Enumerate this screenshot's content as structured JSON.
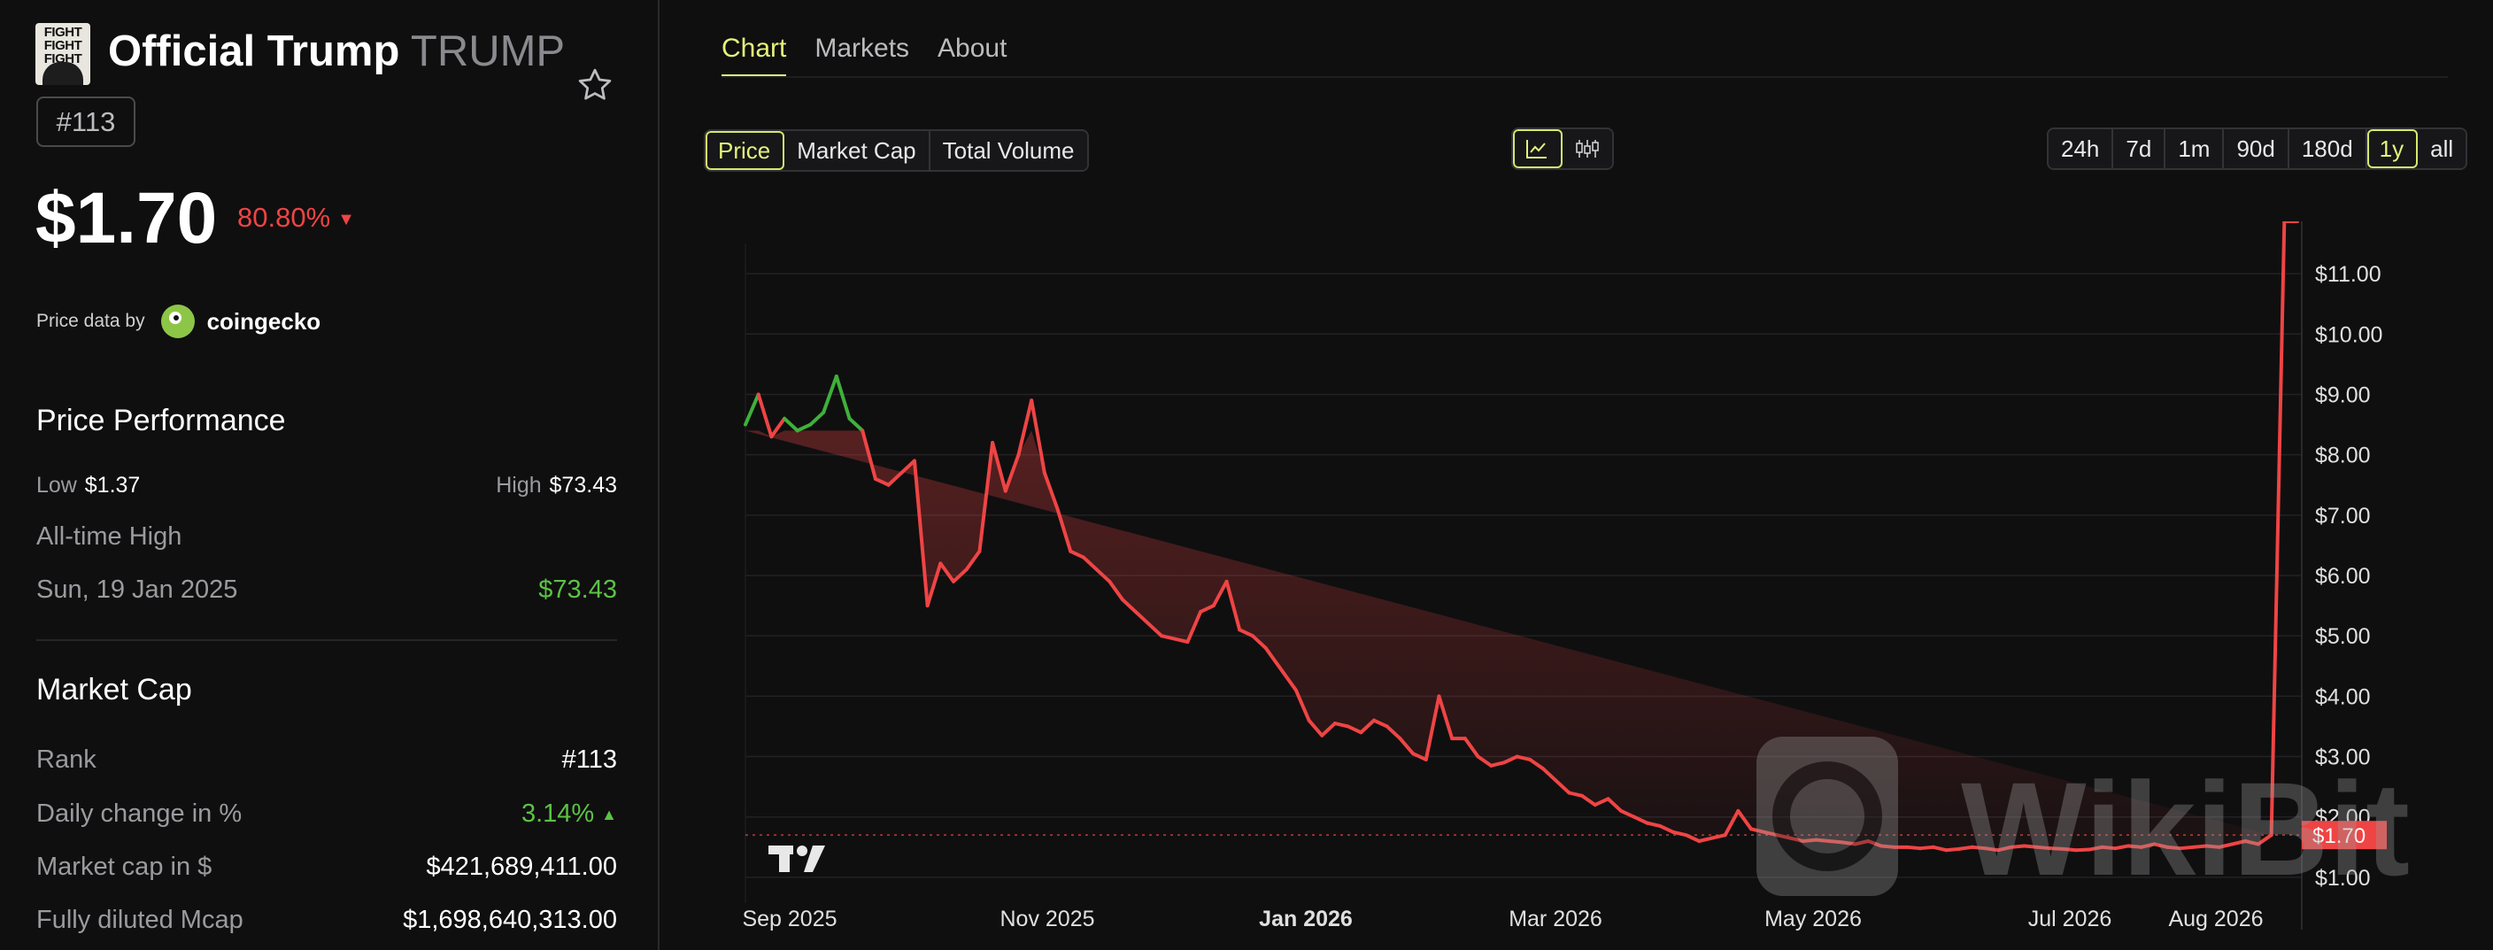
{
  "coin": {
    "name": "Official Trump",
    "symbol": "TRUMP",
    "rank_badge": "#113",
    "price": "$1.70",
    "change": "80.80%",
    "logo_text": [
      "FIGHT",
      "FIGHT",
      "FIGHT"
    ]
  },
  "price_data": {
    "by": "Price data by",
    "provider": "coingecko"
  },
  "performance": {
    "title": "Price Performance",
    "low_label": "Low",
    "low_value": "$1.37",
    "high_label": "High",
    "high_value": "$73.43",
    "ath_label": "All-time High",
    "ath_date": "Sun, 19 Jan 2025",
    "ath_value": "$73.43"
  },
  "market_cap": {
    "title": "Market Cap",
    "rank_label": "Rank",
    "rank_value": "#113",
    "daily_label": "Daily change in %",
    "daily_value": "3.14%",
    "mcap_label": "Market cap in $",
    "mcap_value": "$421,689,411.00",
    "fdv_label": "Fully diluted Mcap",
    "fdv_value": "$1,698,640,313.00"
  },
  "tabs": [
    "Chart",
    "Markets",
    "About"
  ],
  "metric_buttons": [
    "Price",
    "Market Cap",
    "Total Volume"
  ],
  "range_buttons": [
    "24h",
    "7d",
    "1m",
    "90d",
    "180d",
    "1y",
    "all"
  ],
  "colors": {
    "accent": "#e5f27a",
    "down": "#ef4444",
    "up": "#4ade80"
  },
  "watermark": "WikiBit",
  "chart_data": {
    "type": "line",
    "x_ticks": [
      "Sep 2025",
      "Nov 2025",
      "Jan 2026",
      "Mar 2026",
      "May 2026",
      "Jul 2026",
      "Aug 2026"
    ],
    "y_ticks": [
      "$11.00",
      "$10.00",
      "$9.00",
      "$8.00",
      "$7.00",
      "$6.00",
      "$5.00",
      "$4.00",
      "$3.00",
      "$2.00",
      "$1.00"
    ],
    "ylim": [
      0.5,
      11.5
    ],
    "current_price_label": "$1.70",
    "current_price": 1.7,
    "baseline_price": 8.4,
    "x": [
      "2025-08-30",
      "2025-09-02",
      "2025-09-05",
      "2025-09-08",
      "2025-09-11",
      "2025-09-14",
      "2025-09-17",
      "2025-09-20",
      "2025-09-23",
      "2025-09-26",
      "2025-09-29",
      "2025-10-02",
      "2025-10-05",
      "2025-10-08",
      "2025-10-11",
      "2025-10-14",
      "2025-10-17",
      "2025-10-20",
      "2025-10-23",
      "2025-10-26",
      "2025-10-29",
      "2025-11-01",
      "2025-11-04",
      "2025-11-07",
      "2025-11-10",
      "2025-11-13",
      "2025-11-16",
      "2025-11-19",
      "2025-11-22",
      "2025-11-25",
      "2025-11-28",
      "2025-12-01",
      "2025-12-04",
      "2025-12-07",
      "2025-12-10",
      "2025-12-13",
      "2025-12-16",
      "2025-12-19",
      "2025-12-22",
      "2025-12-25",
      "2025-12-28",
      "2026-01-01",
      "2026-01-04",
      "2026-01-07",
      "2026-01-10",
      "2026-01-13",
      "2026-01-16",
      "2026-01-19",
      "2026-01-22",
      "2026-01-25",
      "2026-01-28",
      "2026-01-31",
      "2026-02-03",
      "2026-02-06",
      "2026-02-09",
      "2026-02-12",
      "2026-02-15",
      "2026-02-18",
      "2026-02-21",
      "2026-02-24",
      "2026-02-27",
      "2026-03-02",
      "2026-03-05",
      "2026-03-08",
      "2026-03-11",
      "2026-03-14",
      "2026-03-17",
      "2026-03-20",
      "2026-03-23",
      "2026-03-26",
      "2026-03-29",
      "2026-04-01",
      "2026-04-04",
      "2026-04-07",
      "2026-04-10",
      "2026-04-13",
      "2026-04-16",
      "2026-04-19",
      "2026-04-22",
      "2026-04-25",
      "2026-04-28",
      "2026-05-01",
      "2026-05-04",
      "2026-05-07",
      "2026-05-10",
      "2026-05-13",
      "2026-05-16",
      "2026-05-19",
      "2026-05-22",
      "2026-05-25",
      "2026-05-28",
      "2026-05-31",
      "2026-06-03",
      "2026-06-06",
      "2026-06-09",
      "2026-06-12",
      "2026-06-15",
      "2026-06-18",
      "2026-06-21",
      "2026-06-24",
      "2026-06-27",
      "2026-06-30",
      "2026-07-03",
      "2026-07-06",
      "2026-07-09",
      "2026-07-12",
      "2026-07-15",
      "2026-07-18",
      "2026-07-21",
      "2026-07-24",
      "2026-07-27",
      "2026-07-30",
      "2026-08-02",
      "2026-08-05",
      "2026-08-08",
      "2026-08-11",
      "2026-08-14",
      "2026-08-17",
      "2026-08-20",
      "2026-08-23"
    ],
    "y": [
      8.5,
      9.0,
      8.3,
      8.6,
      8.4,
      8.5,
      8.7,
      9.3,
      8.6,
      8.4,
      7.6,
      7.5,
      7.7,
      7.9,
      5.5,
      6.2,
      5.9,
      6.1,
      6.4,
      8.2,
      7.4,
      8.0,
      8.9,
      7.7,
      7.1,
      6.4,
      6.3,
      6.1,
      5.9,
      5.6,
      5.4,
      5.2,
      5.0,
      4.95,
      4.9,
      5.4,
      5.5,
      5.9,
      5.1,
      5.0,
      4.8,
      4.4,
      4.1,
      3.6,
      3.35,
      3.55,
      3.5,
      3.4,
      3.6,
      3.5,
      3.3,
      3.05,
      2.95,
      4.0,
      3.3,
      3.3,
      3.0,
      2.85,
      2.9,
      3.0,
      2.95,
      2.8,
      2.6,
      2.4,
      2.35,
      2.2,
      2.3,
      2.1,
      2.0,
      1.9,
      1.85,
      1.75,
      1.7,
      1.6,
      1.65,
      1.7,
      2.1,
      1.8,
      1.75,
      1.7,
      1.65,
      1.6,
      1.62,
      1.6,
      1.58,
      1.55,
      1.6,
      1.52,
      1.5,
      1.5,
      1.48,
      1.5,
      1.45,
      1.47,
      1.5,
      1.48,
      1.45,
      1.5,
      1.52,
      1.5,
      1.48,
      1.47,
      1.45,
      1.46,
      1.5,
      1.48,
      1.52,
      1.5,
      1.55,
      1.5,
      1.48,
      1.5,
      1.52,
      1.5,
      1.55,
      1.6,
      1.55,
      1.7
    ]
  }
}
